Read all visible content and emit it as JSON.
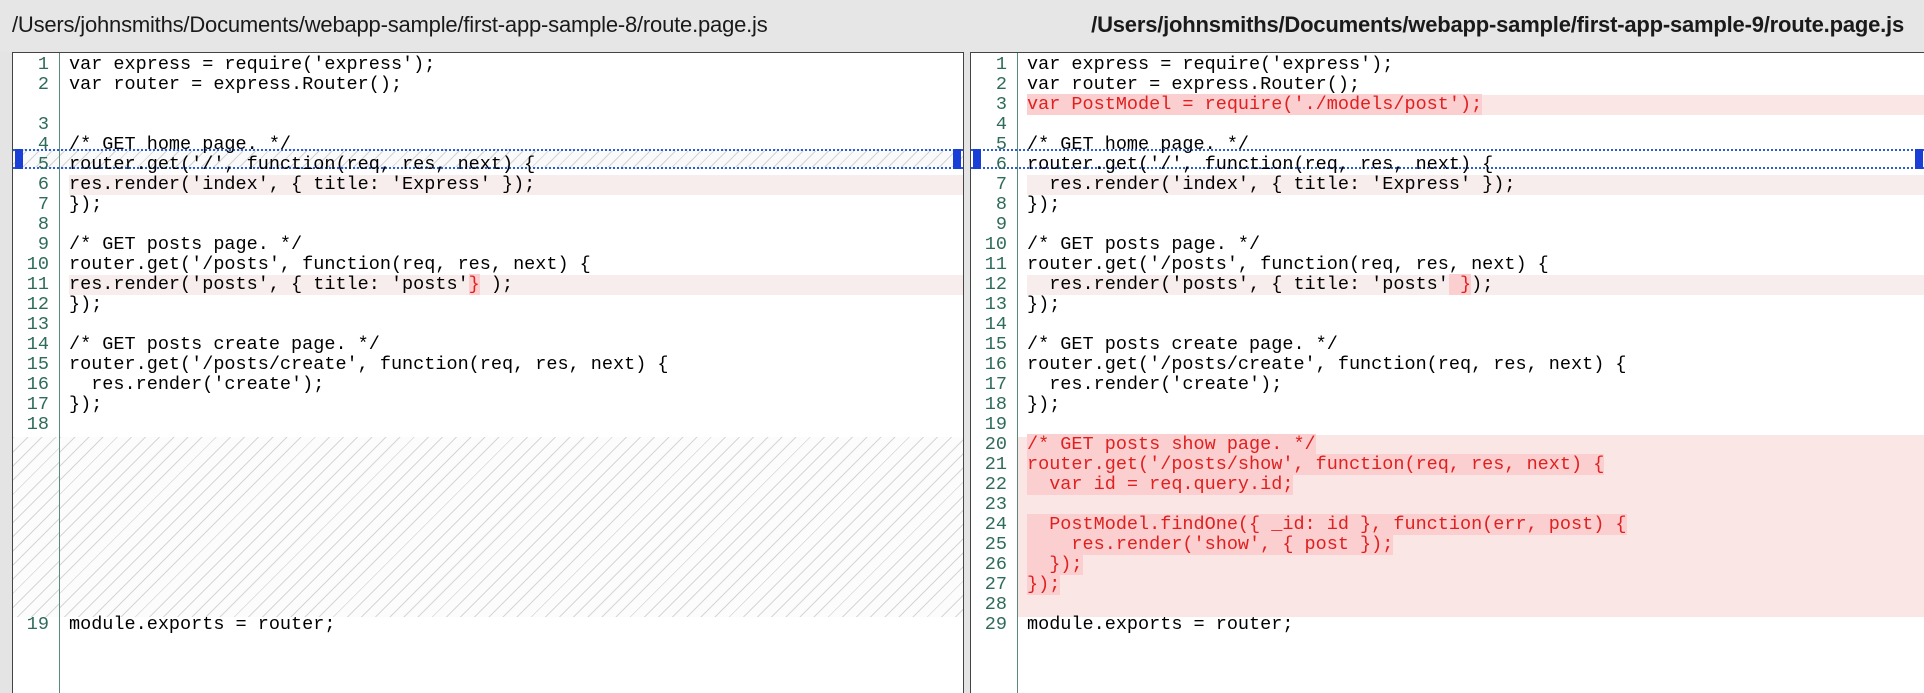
{
  "left": {
    "path": "/Users/johnsmiths/Documents/webapp-sample/first-app-sample-8/route.page.js",
    "lines": [
      {
        "n": "1",
        "t": "var express = require('express');"
      },
      {
        "n": "2",
        "t": "var router = express.Router();"
      },
      {
        "n": "3",
        "t": ""
      },
      {
        "n": "4",
        "t": "/* GET home page. */"
      },
      {
        "n": "5",
        "t": "router.get('/', function(req, res, next) {"
      },
      {
        "n": "6",
        "t": "res.render('index', { title: 'Express' });"
      },
      {
        "n": "7",
        "t": "});"
      },
      {
        "n": "8",
        "t": ""
      },
      {
        "n": "9",
        "t": "/* GET posts page. */"
      },
      {
        "n": "10",
        "t": "router.get('/posts', function(req, res, next) {"
      },
      {
        "n": "11",
        "a": "res.render('posts', { title: 'posts'",
        "b": "}",
        "c": " );"
      },
      {
        "n": "12",
        "t": "});"
      },
      {
        "n": "13",
        "t": ""
      },
      {
        "n": "14",
        "t": "/* GET posts create page. */"
      },
      {
        "n": "15",
        "t": "router.get('/posts/create', function(req, res, next) {"
      },
      {
        "n": "16",
        "t": "  res.render('create');"
      },
      {
        "n": "17",
        "t": "});"
      },
      {
        "n": "18",
        "t": ""
      },
      {
        "n": "19",
        "t": "module.exports = router;"
      }
    ]
  },
  "right": {
    "path": "/Users/johnsmiths/Documents/webapp-sample/first-app-sample-9/route.page.js",
    "lines": [
      {
        "n": "1",
        "t": "var express = require('express');"
      },
      {
        "n": "2",
        "t": "var router = express.Router();"
      },
      {
        "n": "3",
        "t": "var PostModel = require('./models/post');"
      },
      {
        "n": "4",
        "t": ""
      },
      {
        "n": "5",
        "t": "/* GET home page. */"
      },
      {
        "n": "6",
        "t": "router.get('/', function(req, res, next) {"
      },
      {
        "n": "7",
        "t": "  res.render('index', { title: 'Express' });"
      },
      {
        "n": "8",
        "t": "});"
      },
      {
        "n": "9",
        "t": ""
      },
      {
        "n": "10",
        "t": "/* GET posts page. */"
      },
      {
        "n": "11",
        "t": "router.get('/posts', function(req, res, next) {"
      },
      {
        "n": "12",
        "a": "  res.render('posts', { title: 'posts'",
        "b": " }",
        "c": ");"
      },
      {
        "n": "13",
        "t": "});"
      },
      {
        "n": "14",
        "t": ""
      },
      {
        "n": "15",
        "t": "/* GET posts create page. */"
      },
      {
        "n": "16",
        "t": "router.get('/posts/create', function(req, res, next) {"
      },
      {
        "n": "17",
        "t": "  res.render('create');"
      },
      {
        "n": "18",
        "t": "});"
      },
      {
        "n": "19",
        "t": ""
      },
      {
        "n": "20",
        "t": "/* GET posts show page. */"
      },
      {
        "n": "21",
        "t": "router.get('/posts/show', function(req, res, next) {"
      },
      {
        "n": "22",
        "t": "  var id = req.query.id;"
      },
      {
        "n": "23",
        "t": ""
      },
      {
        "n": "24",
        "t": "  PostModel.findOne({ _id: id }, function(err, post) {"
      },
      {
        "n": "25",
        "t": "    res.render('show', { post });"
      },
      {
        "n": "26",
        "t": "  });"
      },
      {
        "n": "27",
        "t": "});"
      },
      {
        "n": "28",
        "t": ""
      },
      {
        "n": "29",
        "t": "module.exports = router;"
      }
    ]
  },
  "colors": {
    "added_text": "#e02020",
    "added_bg": "#fbe6e6",
    "changed_bg": "#f8eded",
    "marker": "#1a3fd6",
    "line_number": "#2e6b5b"
  }
}
